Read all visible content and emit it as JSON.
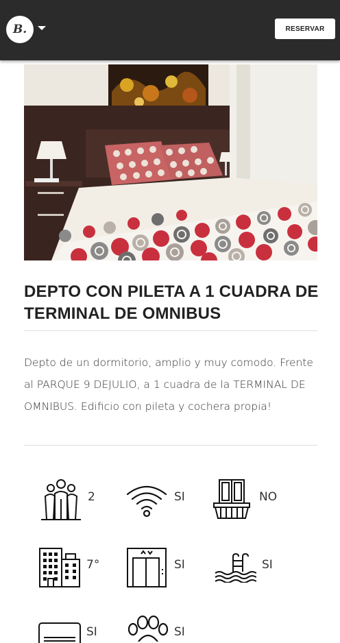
{
  "header": {
    "logo_text": "B.",
    "reserve_label": "RESERVAR",
    "background": "#2b2b2b"
  },
  "listing": {
    "title": "DEPTO CON PILETA A 1 CUADRA DE TERMINAL DE OMNIBUS",
    "description": "Depto de un dormitorio, amplio y muy comodo. Frente al PARQUE 9 DEJULIO, a 1 cuadra de la TERMINAL DE OMNIBUS. Edificio con pileta y cochera propia!"
  },
  "amenities": [
    {
      "icon": "people-icon",
      "value": "2"
    },
    {
      "icon": "wifi-icon",
      "value": "SI"
    },
    {
      "icon": "balcony-icon",
      "value": "NO"
    },
    {
      "icon": "building-icon",
      "value": "7°"
    },
    {
      "icon": "elevator-icon",
      "value": "SI"
    },
    {
      "icon": "pool-icon",
      "value": "SI"
    },
    {
      "icon": "air-conditioner-icon",
      "value": "SI"
    },
    {
      "icon": "paw-icon",
      "value": "SI"
    }
  ]
}
